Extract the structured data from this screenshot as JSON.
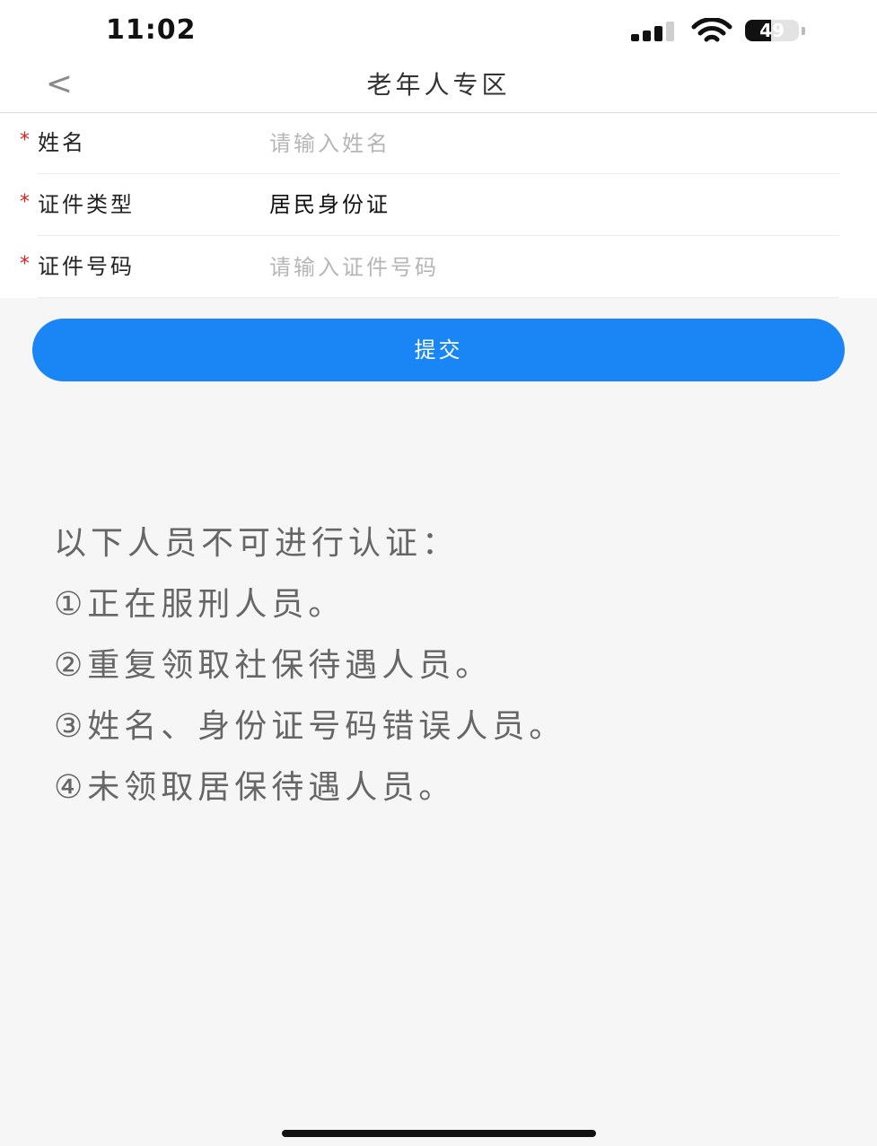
{
  "status_bar": {
    "time": "11:02",
    "battery": "49",
    "battery_level": 0.49
  },
  "nav": {
    "back_icon": "<",
    "title": "老年人专区"
  },
  "form": {
    "required_mark": "*",
    "fields": [
      {
        "label": "姓名",
        "placeholder": "请输入姓名",
        "value": ""
      },
      {
        "label": "证件类型",
        "value": "居民身份证"
      },
      {
        "label": "证件号码",
        "placeholder": "请输入证件号码",
        "value": ""
      }
    ]
  },
  "submit_label": "提交",
  "notice": {
    "title": "以下人员不可进行认证：",
    "items": [
      "①正在服刑人员。",
      "②重复领取社保待遇人员。",
      "③姓名、身份证号码错误人员。",
      "④未领取居保待遇人员。"
    ]
  },
  "colors": {
    "accent": "#1a86f5",
    "required": "#e02020",
    "placeholder": "#b6b6b6"
  }
}
